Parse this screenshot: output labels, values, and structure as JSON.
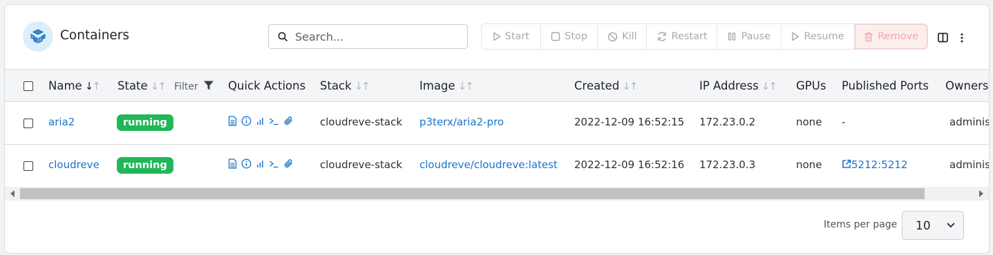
{
  "header": {
    "title": "Containers",
    "search_placeholder": "Search...",
    "actions": [
      {
        "label": "Start",
        "icon": "play-icon"
      },
      {
        "label": "Stop",
        "icon": "square-icon"
      },
      {
        "label": "Kill",
        "icon": "ban-icon"
      },
      {
        "label": "Restart",
        "icon": "refresh-icon"
      },
      {
        "label": "Pause",
        "icon": "pause-icon"
      },
      {
        "label": "Resume",
        "icon": "play-icon"
      },
      {
        "label": "Remove",
        "icon": "trash-icon"
      }
    ]
  },
  "table": {
    "columns": {
      "name": "Name",
      "state": "State",
      "filter": "Filter",
      "quick_actions": "Quick Actions",
      "stack": "Stack",
      "image": "Image",
      "created": "Created",
      "ip": "IP Address",
      "gpus": "GPUs",
      "ports": "Published Ports",
      "owners": "Owners"
    },
    "rows": [
      {
        "name": "aria2",
        "state": "running",
        "stack": "cloudreve-stack",
        "image": "p3terx/aria2-pro",
        "created": "2022-12-09 16:52:15",
        "ip": "172.23.0.2",
        "gpus": "none",
        "ports": "-",
        "owner": "adminis"
      },
      {
        "name": "cloudreve",
        "state": "running",
        "stack": "cloudreve-stack",
        "image": "cloudreve/cloudreve:latest",
        "created": "2022-12-09 16:52:16",
        "ip": "172.23.0.3",
        "gpus": "none",
        "ports": "5212:5212",
        "owner": "adminis"
      }
    ]
  },
  "footer": {
    "items_per_page_label": "Items per page",
    "items_per_page_value": "10"
  },
  "colors": {
    "accent": "#1a73c8",
    "running": "#22b659",
    "remove_bg": "#fdeeee",
    "remove_text": "#f3a6a6"
  }
}
